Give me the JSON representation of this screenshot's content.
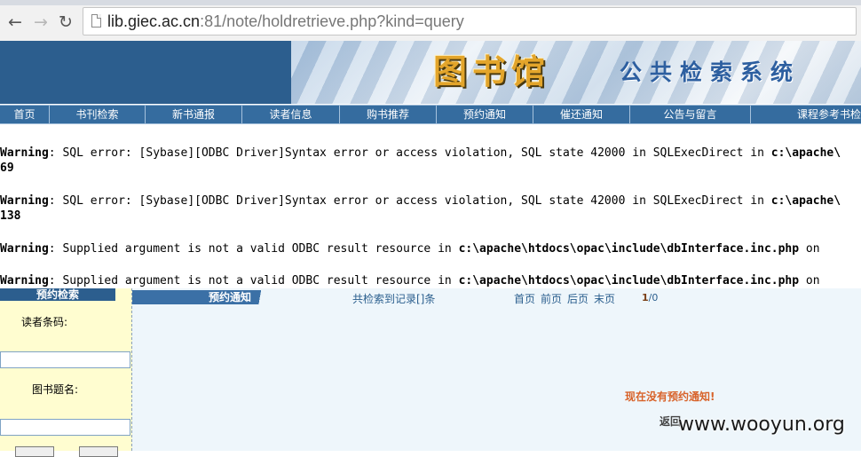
{
  "browser": {
    "url_host": "lib.giec.ac.cn",
    "url_rest": ":81/note/holdretrieve.php?kind=query",
    "back_glyph": "←",
    "forward_glyph": "→",
    "reload_glyph": "↻"
  },
  "header": {
    "banner_title": "图书馆",
    "banner_subtitle": "公共检索系统"
  },
  "menu": {
    "items": [
      {
        "label": "首页"
      },
      {
        "label": "书刊检索"
      },
      {
        "label": "新书通报"
      },
      {
        "label": "读者信息"
      },
      {
        "label": "购书推荐"
      },
      {
        "label": "预约通知"
      },
      {
        "label": "催还通知"
      },
      {
        "label": "公告与留言"
      },
      {
        "label": "课程参考书检"
      }
    ]
  },
  "warnings": [
    {
      "prefix": "Warning",
      "text": ": SQL error: [Sybase][ODBC Driver]Syntax error or access violation, SQL state 42000 in SQLExecDirect in ",
      "path": "c:\\apache\\"
    },
    {
      "line2": "69"
    },
    {
      "prefix": "Warning",
      "text": ": SQL error: [Sybase][ODBC Driver]Syntax error or access violation, SQL state 42000 in SQLExecDirect in ",
      "path": "c:\\apache\\"
    },
    {
      "line2": "138"
    },
    {
      "prefix": "Warning",
      "text": ": Supplied argument is not a valid ODBC result resource in ",
      "path": "c:\\apache\\htdocs\\opac\\include\\dbInterface.inc.php",
      "suffix": " on"
    },
    {
      "prefix": "Warning",
      "text": ": Supplied argument is not a valid ODBC result resource in ",
      "path": "c:\\apache\\htdocs\\opac\\include\\dbInterface.inc.php",
      "suffix": " on"
    }
  ],
  "sidebar": {
    "title": "预约检索",
    "reader_label": "读者条码:",
    "book_label": "图书题名:"
  },
  "main": {
    "tab_title": "预约通知",
    "records_text": "共检索到记录[]条",
    "pager": [
      "首页",
      "前页",
      "后页",
      "末页"
    ],
    "page_current": "1",
    "page_sep": "/",
    "page_total": "0",
    "no_notice": "现在没有预约通知!",
    "back": "返回"
  },
  "watermark": "www.wooyun.org"
}
